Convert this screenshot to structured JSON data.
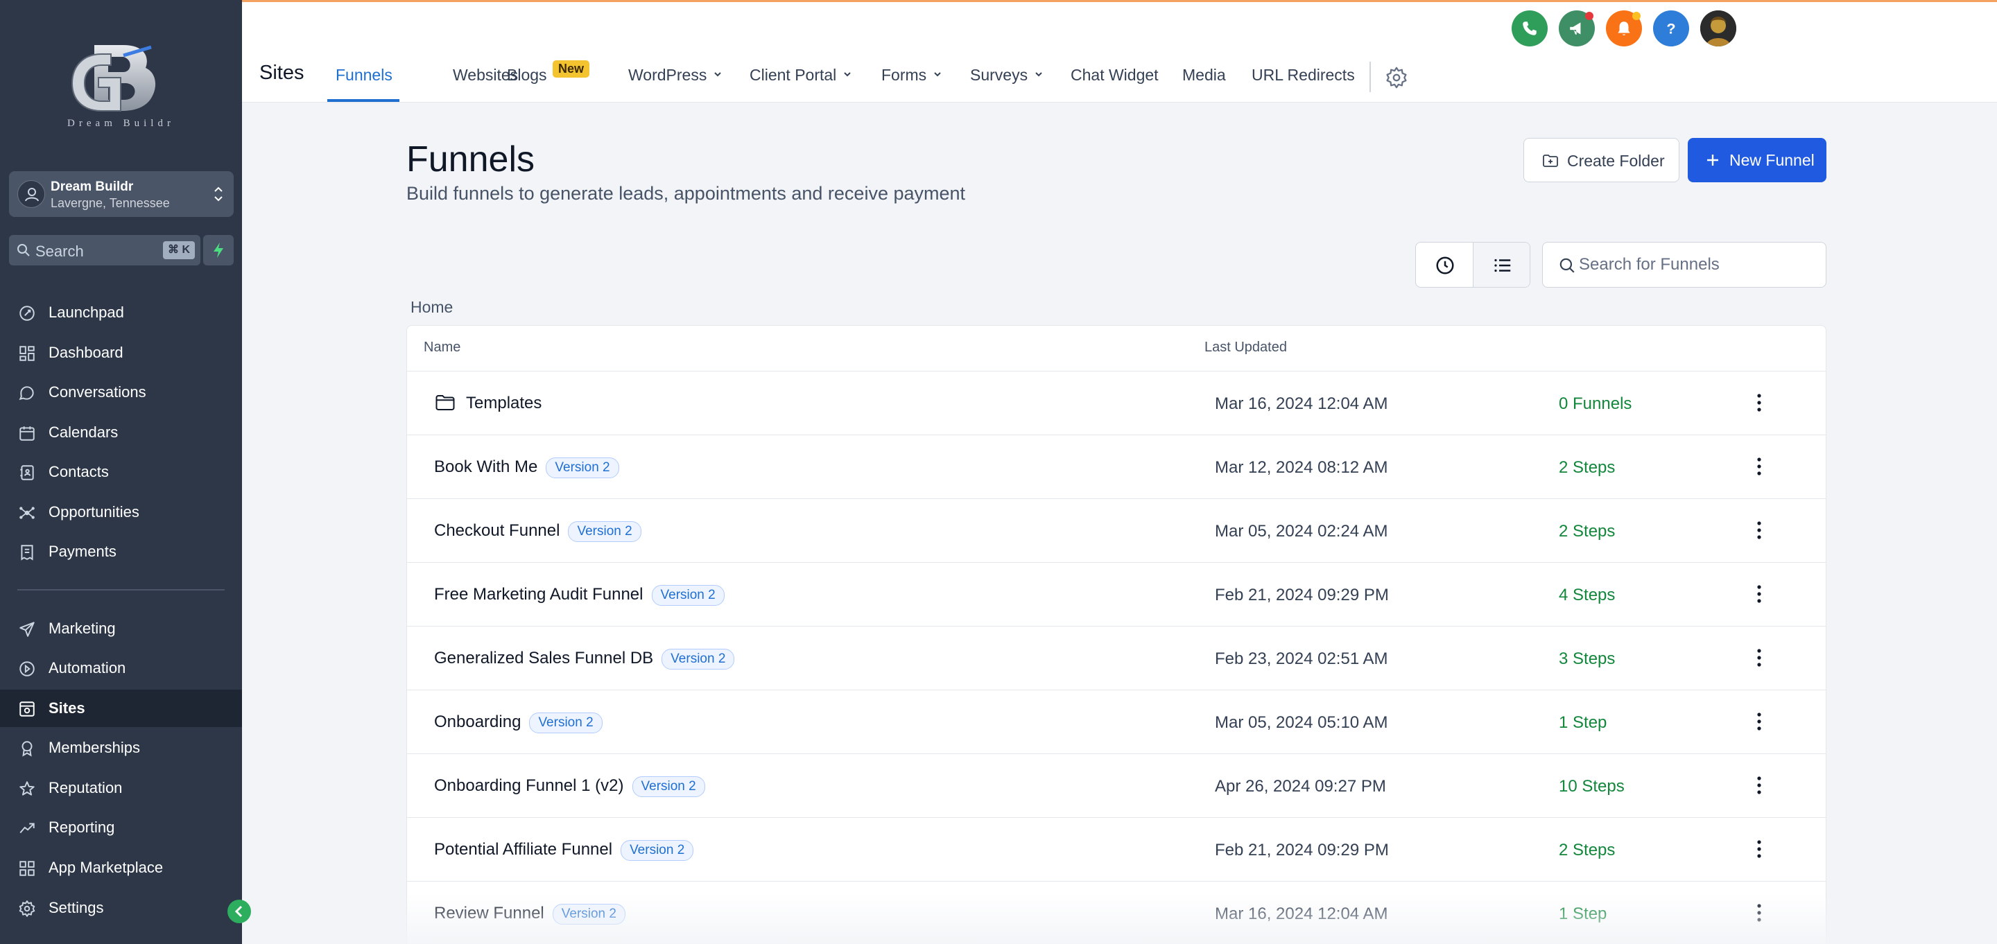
{
  "sidebar": {
    "logo_wordmark": "Dream Buildr",
    "location": {
      "name": "Dream Buildr",
      "address": "Lavergne, Tennessee"
    },
    "search": {
      "placeholder": "Search",
      "shortcut": "⌘ K"
    },
    "nav_top": [
      {
        "label": "Launchpad",
        "icon": "rocket-icon"
      },
      {
        "label": "Dashboard",
        "icon": "grid-icon"
      },
      {
        "label": "Conversations",
        "icon": "chat-icon"
      },
      {
        "label": "Calendars",
        "icon": "calendar-icon"
      },
      {
        "label": "Contacts",
        "icon": "contacts-icon"
      },
      {
        "label": "Opportunities",
        "icon": "network-icon"
      },
      {
        "label": "Payments",
        "icon": "receipt-icon"
      }
    ],
    "nav_bottom": [
      {
        "label": "Marketing",
        "icon": "send-icon"
      },
      {
        "label": "Automation",
        "icon": "automation-icon"
      },
      {
        "label": "Sites",
        "icon": "sites-icon",
        "active": true
      },
      {
        "label": "Memberships",
        "icon": "award-icon"
      },
      {
        "label": "Reputation",
        "icon": "star-icon"
      },
      {
        "label": "Reporting",
        "icon": "trend-icon"
      },
      {
        "label": "App Marketplace",
        "icon": "apps-icon"
      },
      {
        "label": "Settings",
        "icon": "gear-icon"
      }
    ]
  },
  "topbar": {
    "section_title": "Sites",
    "tabs": [
      {
        "label": "Funnels",
        "active": true
      },
      {
        "label": "Websites"
      },
      {
        "label": "Blogs",
        "badge": "New"
      },
      {
        "label": "WordPress",
        "dropdown": true
      },
      {
        "label": "Client Portal",
        "dropdown": true
      },
      {
        "label": "Forms",
        "dropdown": true
      },
      {
        "label": "Surveys",
        "dropdown": true
      },
      {
        "label": "Chat Widget"
      },
      {
        "label": "Media"
      },
      {
        "label": "URL Redirects"
      }
    ]
  },
  "main": {
    "title": "Funnels",
    "subtitle": "Build funnels to generate leads, appointments and receive payment",
    "create_folder_label": "Create Folder",
    "new_funnel_label": "New Funnel",
    "search_placeholder": "Search for Funnels",
    "breadcrumb": "Home",
    "table": {
      "headers": {
        "name": "Name",
        "updated": "Last Updated"
      },
      "rows": [
        {
          "name": "Templates",
          "type": "folder",
          "updated": "Mar 16, 2024 12:04 AM",
          "steps": "0 Funnels"
        },
        {
          "name": "Book With Me",
          "version": "Version 2",
          "updated": "Mar 12, 2024 08:12 AM",
          "steps": "2 Steps"
        },
        {
          "name": "Checkout Funnel",
          "version": "Version 2",
          "updated": "Mar 05, 2024 02:24 AM",
          "steps": "2 Steps"
        },
        {
          "name": "Free Marketing Audit Funnel",
          "version": "Version 2",
          "updated": "Feb 21, 2024 09:29 PM",
          "steps": "4 Steps"
        },
        {
          "name": "Generalized Sales Funnel DB",
          "version": "Version 2",
          "updated": "Feb 23, 2024 02:51 AM",
          "steps": "3 Steps"
        },
        {
          "name": "Onboarding",
          "version": "Version 2",
          "updated": "Mar 05, 2024 05:10 AM",
          "steps": "1 Step"
        },
        {
          "name": "Onboarding Funnel 1 (v2)",
          "version": "Version 2",
          "updated": "Apr 26, 2024 09:27 PM",
          "steps": "10 Steps"
        },
        {
          "name": "Potential Affiliate Funnel",
          "version": "Version 2",
          "updated": "Feb 21, 2024 09:29 PM",
          "steps": "2 Steps"
        },
        {
          "name": "Review Funnel",
          "version": "Version 2",
          "updated": "Mar 16, 2024 12:04 AM",
          "steps": "1 Step"
        }
      ]
    }
  },
  "colors": {
    "sidebar_bg": "#2d3748",
    "accent": "#1f5ae0",
    "tab_active": "#1f6fd1",
    "steps_green": "#12873b",
    "badge_new": "#f4c430"
  },
  "header_actions": [
    {
      "icon": "phone-icon",
      "color": "#2f9e5a"
    },
    {
      "icon": "megaphone-icon",
      "color": "#3f8f66"
    },
    {
      "icon": "bell-icon",
      "color": "#f97316"
    },
    {
      "icon": "help-icon",
      "color": "#2e7dd8"
    },
    {
      "icon": "avatar",
      "color": "#3b3b3b"
    }
  ]
}
